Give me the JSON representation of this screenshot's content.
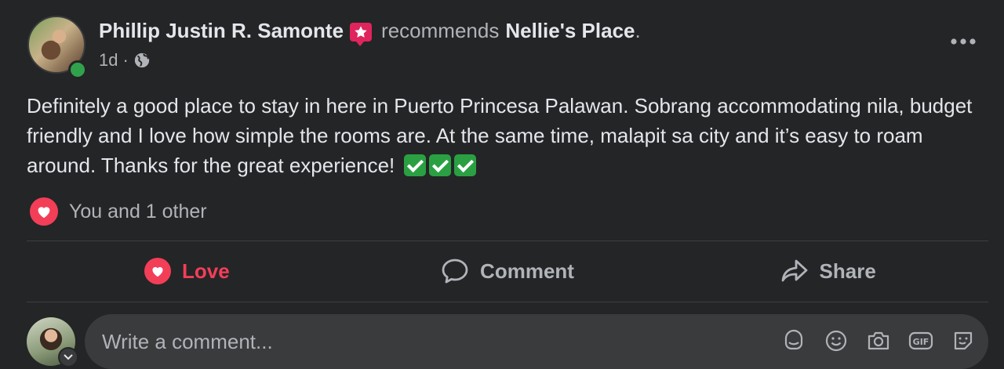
{
  "post": {
    "author": "Phillip Justin R. Samonte",
    "verb": "recommends",
    "place": "Nellie's Place",
    "period": ".",
    "time": "1d",
    "separator": "·",
    "body": "Definitely a good place to stay in here in Puerto Princesa Palawan. Sobrang accommodating nila, budget friendly and I love how simple the rooms are. At the same time, malapit sa city and it’s easy to roam around. Thanks for the great experience!",
    "reactions_text": "You and 1 other"
  },
  "actions": {
    "love_label": "Love",
    "comment_label": "Comment",
    "share_label": "Share"
  },
  "comment_box": {
    "placeholder": "Write a comment..."
  },
  "icons": [
    "recommendation-badge-icon",
    "globe-icon",
    "more-options-icon",
    "check-mark-emoji",
    "love-reaction-icon",
    "comment-icon",
    "share-icon",
    "avatar-sticker-icon",
    "emoji-icon",
    "camera-icon",
    "gif-icon",
    "sticker-icon"
  ],
  "colors": {
    "background": "#242526",
    "love": "#f33e58",
    "online": "#31a24c",
    "badge": "#e0245e",
    "check": "#2aa043"
  }
}
